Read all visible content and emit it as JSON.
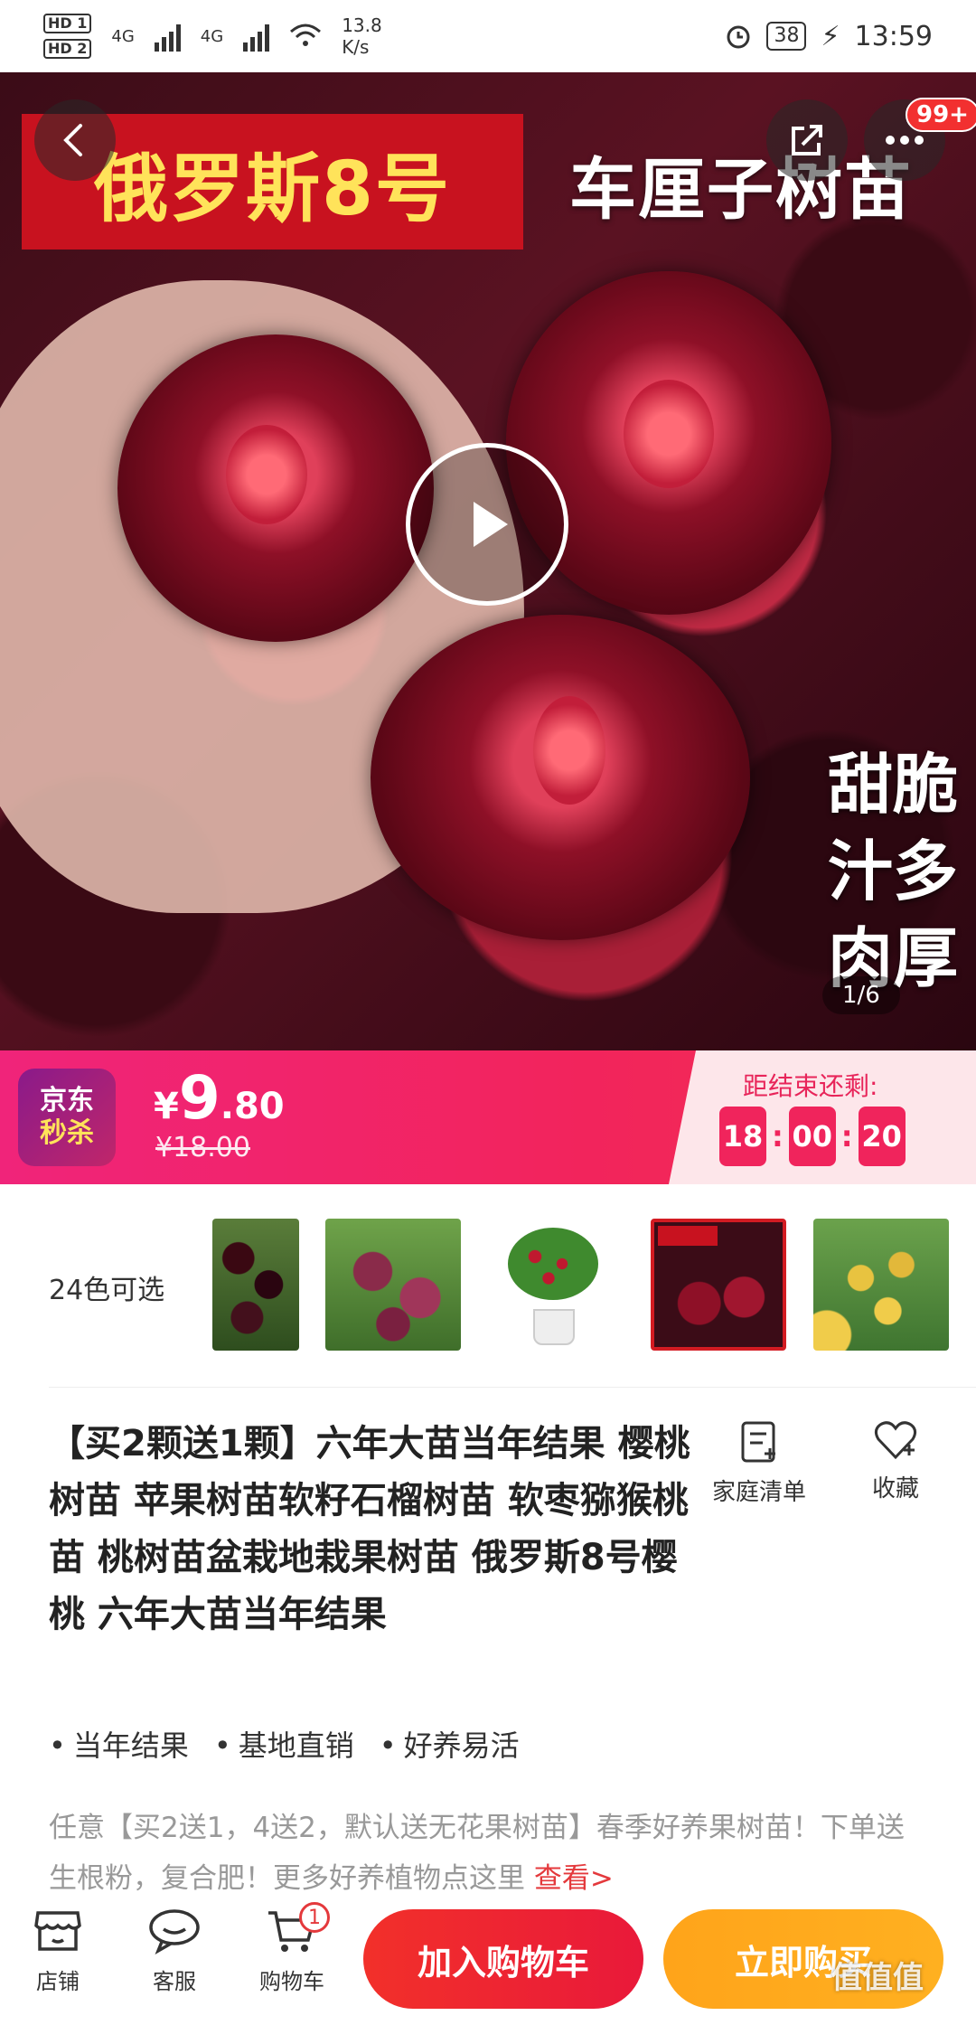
{
  "status_bar": {
    "hd1": "HD 1",
    "hd2": "HD 2",
    "network1": "4G",
    "network2": "4G",
    "speed": "13.8",
    "speed_unit": "K/s",
    "battery": "38",
    "time": "13:59"
  },
  "hero": {
    "banner_left": "俄罗斯8号",
    "banner_right": "车厘子树苗",
    "tagline": [
      "甜脆",
      "汁多",
      "肉厚"
    ],
    "page_indicator": "1/6",
    "more_badge": "99+",
    "icons": {
      "back": "back-arrow-icon",
      "share": "share-icon",
      "more": "more-dots-icon",
      "play": "play-icon"
    }
  },
  "flash_sale": {
    "logo_line1": "京东",
    "logo_line2": "秒杀",
    "currency": "¥",
    "price_int": "9",
    "price_dec": ".80",
    "price_old": "¥18.00",
    "countdown_label": "距结束还剩:",
    "hours": "18",
    "minutes": "00",
    "seconds": "20",
    "colors": {
      "accent": "#f0245c",
      "panel": "#fde6ea"
    }
  },
  "variants": {
    "label": "24色可选"
  },
  "product": {
    "title": "【买2颗送1颗】六年大苗当年结果 樱桃树苗 苹果树苗软籽石榴树苗 软枣猕猴桃苗 桃树苗盆栽地栽果树苗 俄罗斯8号樱桃 六年大苗当年结果",
    "actions": [
      {
        "label": "家庭清单",
        "icon": "list-icon"
      },
      {
        "label": "收藏",
        "icon": "heart-icon"
      }
    ],
    "features": [
      "当年结果",
      "基地直销",
      "好养易活"
    ],
    "promo_text": "任意【买2送1，4送2，默认送无花果树苗】春季好养果树苗！下单送生根粉，复合肥！更多好养植物点这里 ",
    "promo_link": "查看>"
  },
  "bottom_bar": {
    "store_label": "店铺",
    "service_label": "客服",
    "cart_label": "购物车",
    "cart_count": "1",
    "add_to_cart": "加入购物车",
    "buy_now": "立即购买",
    "colors": {
      "add_to_cart": "#f2302a",
      "buy_now": "#ffa41a"
    }
  },
  "watermark": "值值值"
}
